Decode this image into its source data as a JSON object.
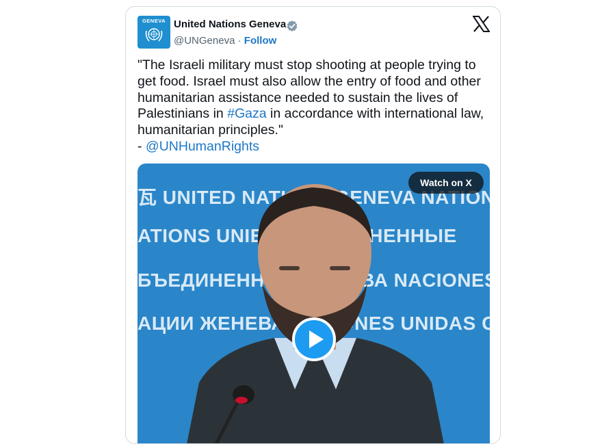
{
  "tweet": {
    "account_name": "United Nations Geneva",
    "handle": "@UNGeneva",
    "separator": "·",
    "follow_label": "Follow",
    "avatar_text": "GENEVA",
    "text_segments": [
      "\"The Israeli military must stop shooting at people trying to get food. Israel must also allow the entry of food and other humanitarian assistance needed to sustain the lives of Palestinians in ",
      "#Gaza",
      " in accordance with international law, humanitarian principles.\"",
      "- ",
      "@UNHumanRights"
    ],
    "watch_label": "Watch on X",
    "backdrop_lines": [
      "瓦  UNITED NATIONS GENEVA  NATIONS",
      "ATIONS UNIES  ОБЪЕДИНЕННЫЕ",
      "БЪЕДИНЕННЫЕ  ЖЕНЕВА  NACIONES",
      "АЦИИ ЖЕНЕВА  NACIONES UNIDAS GE"
    ]
  },
  "icons": {
    "verified": "verified-badge-icon",
    "x_logo": "x-logo-icon",
    "play": "play-icon",
    "un_emblem": "un-emblem-icon"
  },
  "colors": {
    "link": "#1d77c7",
    "play_button": "#1d9bf0",
    "backdrop_blue": "#2a86c9"
  }
}
